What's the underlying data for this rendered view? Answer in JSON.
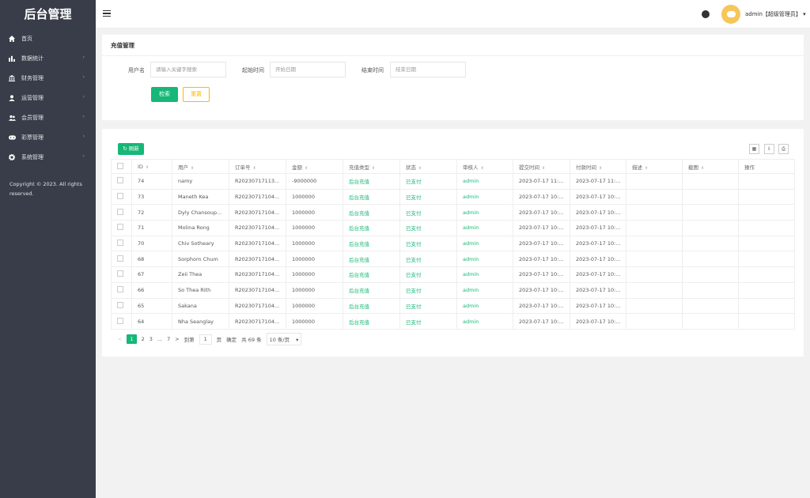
{
  "sidebar": {
    "logo": "后台管理",
    "items": [
      {
        "label": "首页",
        "icon": "home-icon"
      },
      {
        "label": "数据统计",
        "icon": "chart-icon"
      },
      {
        "label": "财务管理",
        "icon": "bank-icon"
      },
      {
        "label": "运营管理",
        "icon": "user-icon"
      },
      {
        "label": "会员管理",
        "icon": "users-icon"
      },
      {
        "label": "彩票管理",
        "icon": "game-icon"
      },
      {
        "label": "系统管理",
        "icon": "gear-icon"
      }
    ],
    "copyright": "Copyright © 2023. All rights reserved."
  },
  "header": {
    "user": "admin【超级管理员】"
  },
  "filter": {
    "title": "充值管理",
    "username_label": "用户名",
    "username_placeholder": "请输入关键字搜索",
    "start_label": "起始时间",
    "start_placeholder": "开始日期",
    "end_label": "结束时间",
    "end_placeholder": "结束日期",
    "search_btn": "检索",
    "reset_btn": "重置"
  },
  "table": {
    "refresh_btn": "刷新",
    "columns": [
      "ID",
      "用户",
      "订单号",
      "金额",
      "充值类型",
      "状态",
      "审核人",
      "提交时间",
      "付款时间",
      "描述",
      "截图",
      "操作"
    ],
    "rows": [
      {
        "id": "74",
        "user": "namy",
        "order": "R20230717113...",
        "amount": "-9000000",
        "type": "后台充值",
        "status": "已支付",
        "auditor": "admin",
        "submit": "2023-07-17 11:...",
        "pay": "2023-07-17 11:..."
      },
      {
        "id": "73",
        "user": "Maneth Kea",
        "order": "R20230717104...",
        "amount": "1000000",
        "type": "后台充值",
        "status": "已支付",
        "auditor": "admin",
        "submit": "2023-07-17 10:...",
        "pay": "2023-07-17 10:..."
      },
      {
        "id": "72",
        "user": "Dyly Chansoup...",
        "order": "R20230717104...",
        "amount": "1000000",
        "type": "后台充值",
        "status": "已支付",
        "auditor": "admin",
        "submit": "2023-07-17 10:...",
        "pay": "2023-07-17 10:..."
      },
      {
        "id": "71",
        "user": "Molina Rong",
        "order": "R20230717104...",
        "amount": "1000000",
        "type": "后台充值",
        "status": "已支付",
        "auditor": "admin",
        "submit": "2023-07-17 10:...",
        "pay": "2023-07-17 10:..."
      },
      {
        "id": "70",
        "user": "Chiv Sotheary",
        "order": "R20230717104...",
        "amount": "1000000",
        "type": "后台充值",
        "status": "已支付",
        "auditor": "admin",
        "submit": "2023-07-17 10:...",
        "pay": "2023-07-17 10:..."
      },
      {
        "id": "68",
        "user": "Sorphorn Chum",
        "order": "R20230717104...",
        "amount": "1000000",
        "type": "后台充值",
        "status": "已支付",
        "auditor": "admin",
        "submit": "2023-07-17 10:...",
        "pay": "2023-07-17 10:..."
      },
      {
        "id": "67",
        "user": "Zeii Thea",
        "order": "R20230717104...",
        "amount": "1000000",
        "type": "后台充值",
        "status": "已支付",
        "auditor": "admin",
        "submit": "2023-07-17 10:...",
        "pay": "2023-07-17 10:..."
      },
      {
        "id": "66",
        "user": "So Thea Rith",
        "order": "R20230717104...",
        "amount": "1000000",
        "type": "后台充值",
        "status": "已支付",
        "auditor": "admin",
        "submit": "2023-07-17 10:...",
        "pay": "2023-07-17 10:..."
      },
      {
        "id": "65",
        "user": "Sakana",
        "order": "R20230717104...",
        "amount": "1000000",
        "type": "后台充值",
        "status": "已支付",
        "auditor": "admin",
        "submit": "2023-07-17 10:...",
        "pay": "2023-07-17 10:..."
      },
      {
        "id": "64",
        "user": "Nha Seanglay",
        "order": "R20230717104...",
        "amount": "1000000",
        "type": "后台充值",
        "status": "已支付",
        "auditor": "admin",
        "submit": "2023-07-17 10:...",
        "pay": "2023-07-17 10:..."
      }
    ]
  },
  "pager": {
    "prev": "<",
    "pages": [
      "1",
      "2",
      "3",
      "...",
      "7"
    ],
    "next": ">",
    "goto_label": "到第",
    "goto_value": "1",
    "page_unit": "页",
    "confirm": "确定",
    "total": "共 69 条",
    "size": "10 条/页"
  },
  "colors": {
    "accent": "#16b777",
    "warn": "#ffb800",
    "sidebar": "#393d49"
  }
}
